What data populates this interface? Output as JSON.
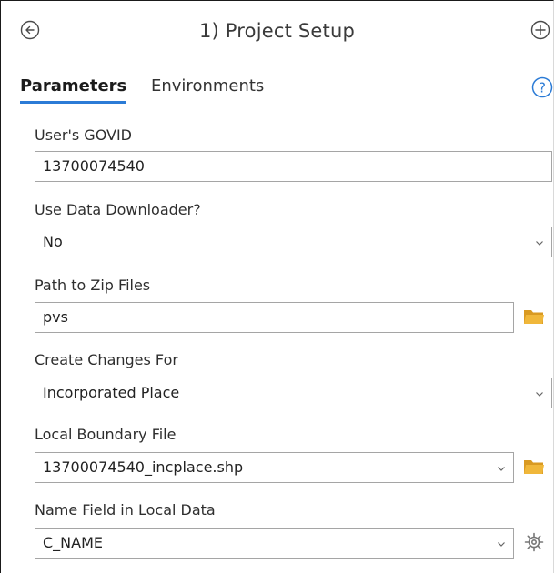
{
  "header": {
    "title": "1) Project Setup"
  },
  "tabs": [
    {
      "label": "Parameters",
      "active": true
    },
    {
      "label": "Environments",
      "active": false
    }
  ],
  "icons": {
    "back": "back-circle-icon",
    "add": "add-circle-icon",
    "help": "help-icon",
    "folder": "folder-icon",
    "settings": "gear-icon",
    "chevron": "chevron-down-icon"
  },
  "colors": {
    "accent": "#2b7bd6",
    "folder": "#e6a72c",
    "border": "#a5a5a5"
  },
  "fields": {
    "govid": {
      "label": "User's GOVID",
      "value": "13700074540"
    },
    "downloader": {
      "label": "Use Data Downloader?",
      "value": "No"
    },
    "zip_path": {
      "label": "Path to Zip Files",
      "value": "pvs"
    },
    "changes_for": {
      "label": "Create Changes For",
      "value": "Incorporated Place"
    },
    "boundary_file": {
      "label": "Local Boundary File",
      "value": "13700074540_incplace.shp"
    },
    "name_field": {
      "label": "Name Field in Local Data",
      "value": "C_NAME"
    }
  }
}
